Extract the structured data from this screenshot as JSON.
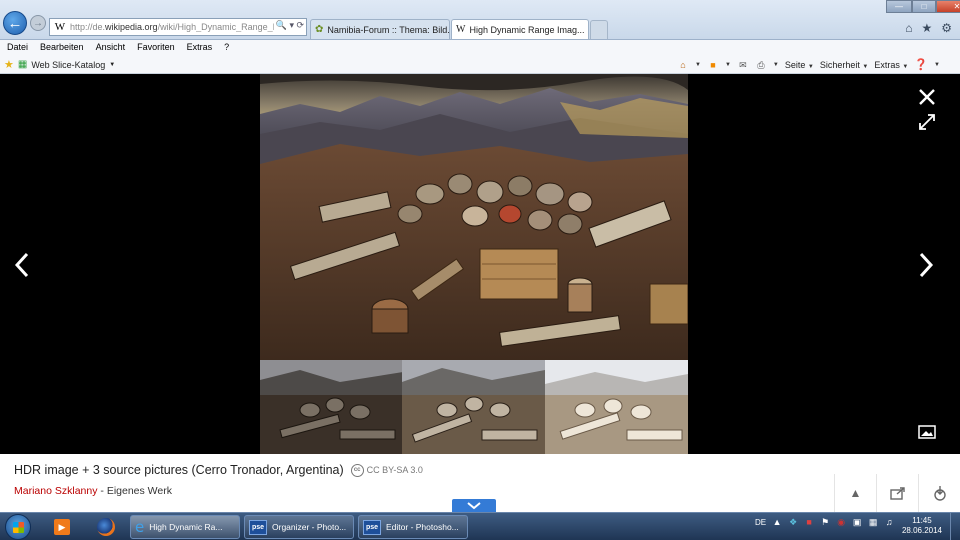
{
  "browser": {
    "address_prefix": "http://de.",
    "address_domain": "wikipedia.org",
    "address_path": "/wiki/High_Dynamic_Range_Im",
    "tabs": [
      {
        "label": "Namibia-Forum :: Thema: Bild..."
      },
      {
        "label": "High Dynamic Range Imag..."
      }
    ]
  },
  "menu": [
    "Datei",
    "Bearbeiten",
    "Ansicht",
    "Favoriten",
    "Extras",
    "?"
  ],
  "favorites": {
    "web_slice": "Web Slice-Katalog"
  },
  "commandbar": {
    "page": "Seite",
    "security": "Sicherheit",
    "tools": "Extras"
  },
  "caption": {
    "title": "HDR image + 3 source pictures (Cerro Tronador, Argentina)",
    "license": "CC BY-SA 3.0",
    "author": "Mariano Szklanny",
    "separator": " - ",
    "source": "Eigenes Werk"
  },
  "taskbar": {
    "items": [
      {
        "label": "High Dynamic Ra..."
      },
      {
        "label": "Organizer - Photo..."
      },
      {
        "label": "Editor - Photosho..."
      }
    ],
    "pse_badge": "pse",
    "language": "DE",
    "time": "11:45",
    "date": "28.06.2014"
  },
  "colors": {
    "viewer_bg": "#000000",
    "author_link": "#ba0000",
    "accent_button": "#347bd6",
    "taskbar": "#2a4468"
  },
  "icons": [
    "back-arrow-icon",
    "forward-arrow-icon",
    "home-icon",
    "star-icon",
    "gear-icon",
    "close-icon",
    "expand-icon",
    "chevron-left-icon",
    "chevron-right-icon",
    "gallery-icon",
    "cc-license-icon",
    "chevron-down-icon"
  ]
}
